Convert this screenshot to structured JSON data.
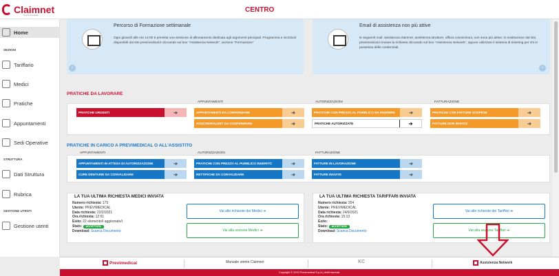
{
  "header": {
    "logo": "Claimnet",
    "logo_sub": "by Previmedical",
    "title": "CENTRO"
  },
  "sidebar": {
    "home": "Home",
    "sections": {
      "sezioni": "SEZIONI",
      "struttura": "STRUTTURA",
      "gestione": "GESTIONE UTENTI"
    },
    "items": [
      "Tariffario",
      "Medici",
      "Pratiche",
      "Appuntamenti",
      "Sedi Operative",
      "Dati Struttura",
      "Rubrica",
      "Gestione utenti"
    ]
  },
  "banners": [
    {
      "title": "Percorso di Formazione settimanale",
      "text": "Ogni giovedì alle ore 14:00 è prevista una sessione di allineamento dedicata agli argomenti principali. Programma e iscrizioni disponibili dal sito previmedical.it cliccando sul box \"Assistenza Network\", sezione \"Formazione\""
    },
    {
      "title": "Email di assistenza non più attive",
      "text": "le seguenti mail: assistenza.claimnet, assistenza.strutture, ufficio.convenzioni, non sono più attive; in sostituzione dal sito previmedical.it inviare la richiesta cliccando sul box \"Assistenza Network\", oppure utilizzare il sistema di ticketing per chi in possesso delle credenziali."
    }
  ],
  "lavorare": {
    "title": "PRATICHE DA LAVORARE",
    "cols": [
      "APPUNTAMENTI",
      "AUTORIZZAZIONI",
      "FATTURAZIONE"
    ],
    "urgenti": "PRATICHE URGENTI",
    "appuntamenti": [
      "APPUNTAMENTI DA CONFERMARE",
      "VOUCHER/ALERT DA CONFERMARE"
    ],
    "autorizzazioni": [
      "PRATICHE CON PREZZO AL PUBBLICO DA INSERIRE",
      "PRATICHE AUTORIZZATE"
    ],
    "fatturazione": [
      "PRATICHE CON FATTURE SOSPESE",
      "FATTURE NON INVIATE"
    ]
  },
  "carico": {
    "title": "PRATICHE IN CARICO A PREVIMEDICAL O ALL'ASSISTITO",
    "cols": [
      "APPUNTAMENTI",
      "AUTORIZZAZIONI",
      "FATTURAZIONE"
    ],
    "appuntamenti": [
      "APPUNTAMENTI IN ATTESA DI AUTORIZZAZIONE",
      "CURE DENTARIE DA CONVALIDARE"
    ],
    "autorizzazioni": [
      "PRATICHE CON PREZZO AL PUBBLICO INSERITO",
      "RETTIFICHE DA CONVALIDARE"
    ],
    "fatturazione": [
      "FATTURE IN LAVORAZIONE",
      "FATTURE INVIATE"
    ]
  },
  "medici_req": {
    "title": "LA TUA ULTIMA RICHIESTA MEDICI INVIATA",
    "numero_label": "Numero richiesta:",
    "numero": "175",
    "utente_label": "Utente:",
    "utente": "PREVIMEDICAL",
    "data_label": "Data richiesta:",
    "data": "22/2/2021",
    "ora_label": "Ora richiesta:",
    "ora": "12:51",
    "esito_label": "Esito:",
    "esito": "22 elemento/i aggiornato/i",
    "stato_label": "Stato:",
    "stato": "ACCETTATA",
    "download_label": "Download:",
    "download": "Scarica Documento",
    "btn1": "Vai alle richieste dei Medici ➔",
    "btn2": "Vai alla sezione Medici ➔"
  },
  "tariffari_req": {
    "title": "LA TUA ULTIMA RICHIESTA TARIFFARI INVIATA",
    "numero_label": "Numero richiesta:",
    "numero": "254",
    "utente_label": "Utente:",
    "utente": "PREVIMEDICAL",
    "data_label": "Data richiesta:",
    "data": "24/9/2021",
    "ora_label": "Ora richiesta:",
    "ora": "15:13",
    "esito_label": "Esito:",
    "esito": "",
    "stato_label": "Stato:",
    "stato": "ACCETTATA",
    "download_label": "Download:",
    "download": "Scarica Documento",
    "btn1": "Vai alle richieste dei Tariffari ➔",
    "btn2": "Vai alla sezione Tariffari ➔"
  },
  "footer": {
    "previmedical": "Previmedical",
    "manuale": "Manuale utente Claimnet",
    "kc": "KC",
    "assistenza": "Assistenza Network",
    "copyright": "Copyright © 2019 Previmedical S.p.A | diritti riservati."
  },
  "colors": {
    "brand": "#c8102e",
    "orange": "#f39a2b",
    "blue": "#1777c7",
    "green": "#27a844"
  }
}
